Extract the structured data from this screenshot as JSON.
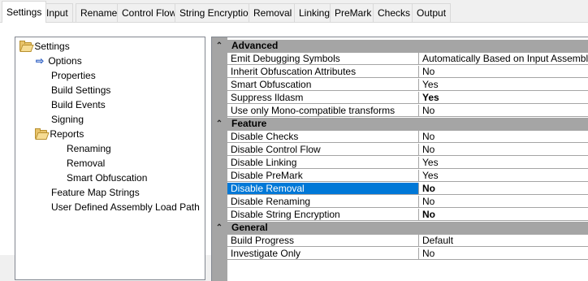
{
  "tabs": [
    {
      "label": "Settings",
      "active": true
    },
    {
      "label": "Input"
    },
    {
      "label": "Rename"
    },
    {
      "label": "Control Flow"
    },
    {
      "label": "String Encryption"
    },
    {
      "label": "Removal"
    },
    {
      "label": "Linking"
    },
    {
      "label": "PreMark"
    },
    {
      "label": "Checks"
    },
    {
      "label": "Output"
    }
  ],
  "tree": {
    "root": {
      "label": "Settings",
      "icon": "folder-open-icon"
    },
    "items": [
      {
        "label": "Options",
        "icon": "arrow-right-icon",
        "selected_marker": true
      },
      {
        "label": "Properties"
      },
      {
        "label": "Build Settings"
      },
      {
        "label": "Build Events"
      },
      {
        "label": "Signing"
      },
      {
        "label": "Reports",
        "icon": "folder-open-icon"
      },
      {
        "label": "Renaming"
      },
      {
        "label": "Removal"
      },
      {
        "label": "Smart Obfuscation"
      },
      {
        "label": "Feature Map Strings"
      },
      {
        "label": "User Defined Assembly Load Path"
      }
    ]
  },
  "grid": {
    "categories": [
      {
        "name": "Advanced",
        "props": [
          {
            "name": "Emit Debugging Symbols",
            "value": "Automatically Based on Input Assemblies"
          },
          {
            "name": "Inherit Obfuscation Attributes",
            "value": "No"
          },
          {
            "name": "Smart Obfuscation",
            "value": "Yes"
          },
          {
            "name": "Suppress Ildasm",
            "value": "Yes",
            "bold": true
          },
          {
            "name": "Use only Mono-compatible transforms",
            "value": "No"
          }
        ]
      },
      {
        "name": "Feature",
        "props": [
          {
            "name": "Disable Checks",
            "value": "No"
          },
          {
            "name": "Disable Control Flow",
            "value": "No"
          },
          {
            "name": "Disable Linking",
            "value": "Yes"
          },
          {
            "name": "Disable PreMark",
            "value": "Yes"
          },
          {
            "name": "Disable Removal",
            "value": "No",
            "bold": true,
            "selected": true
          },
          {
            "name": "Disable Renaming",
            "value": "No"
          },
          {
            "name": "Disable String Encryption",
            "value": "No",
            "bold": true
          }
        ]
      },
      {
        "name": "General",
        "props": [
          {
            "name": "Build Progress",
            "value": "Default"
          },
          {
            "name": "Investigate Only",
            "value": "No"
          }
        ]
      }
    ]
  },
  "colors": {
    "selection": "#0078d7",
    "category_bg": "#a5a5a5"
  }
}
